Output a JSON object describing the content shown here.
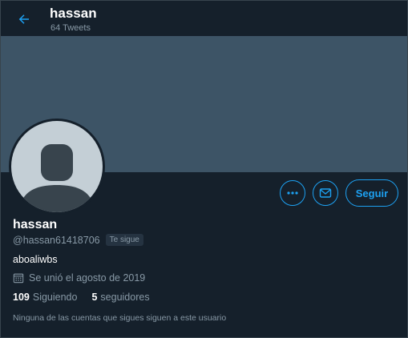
{
  "header": {
    "name": "hassan",
    "tweet_count": "64 Tweets"
  },
  "actions": {
    "follow_label": "Seguir"
  },
  "profile": {
    "display_name": "hassan",
    "handle": "@hassan61418706",
    "follows_you": "Te sigue",
    "bio": "aboaliwbs",
    "joined": "Se unió el agosto de 2019",
    "following_count": "109",
    "following_label": "Siguiendo",
    "followers_count": "5",
    "followers_label": "seguidores",
    "mutuals_text": "Ninguna de las cuentas que sigues siguen a este usuario"
  },
  "colors": {
    "background": "#15202b",
    "accent": "#1da1f2",
    "banner": "#3d5466",
    "muted": "#8899a6"
  },
  "icons": [
    "back-arrow-icon",
    "more-icon",
    "message-icon",
    "calendar-icon"
  ]
}
